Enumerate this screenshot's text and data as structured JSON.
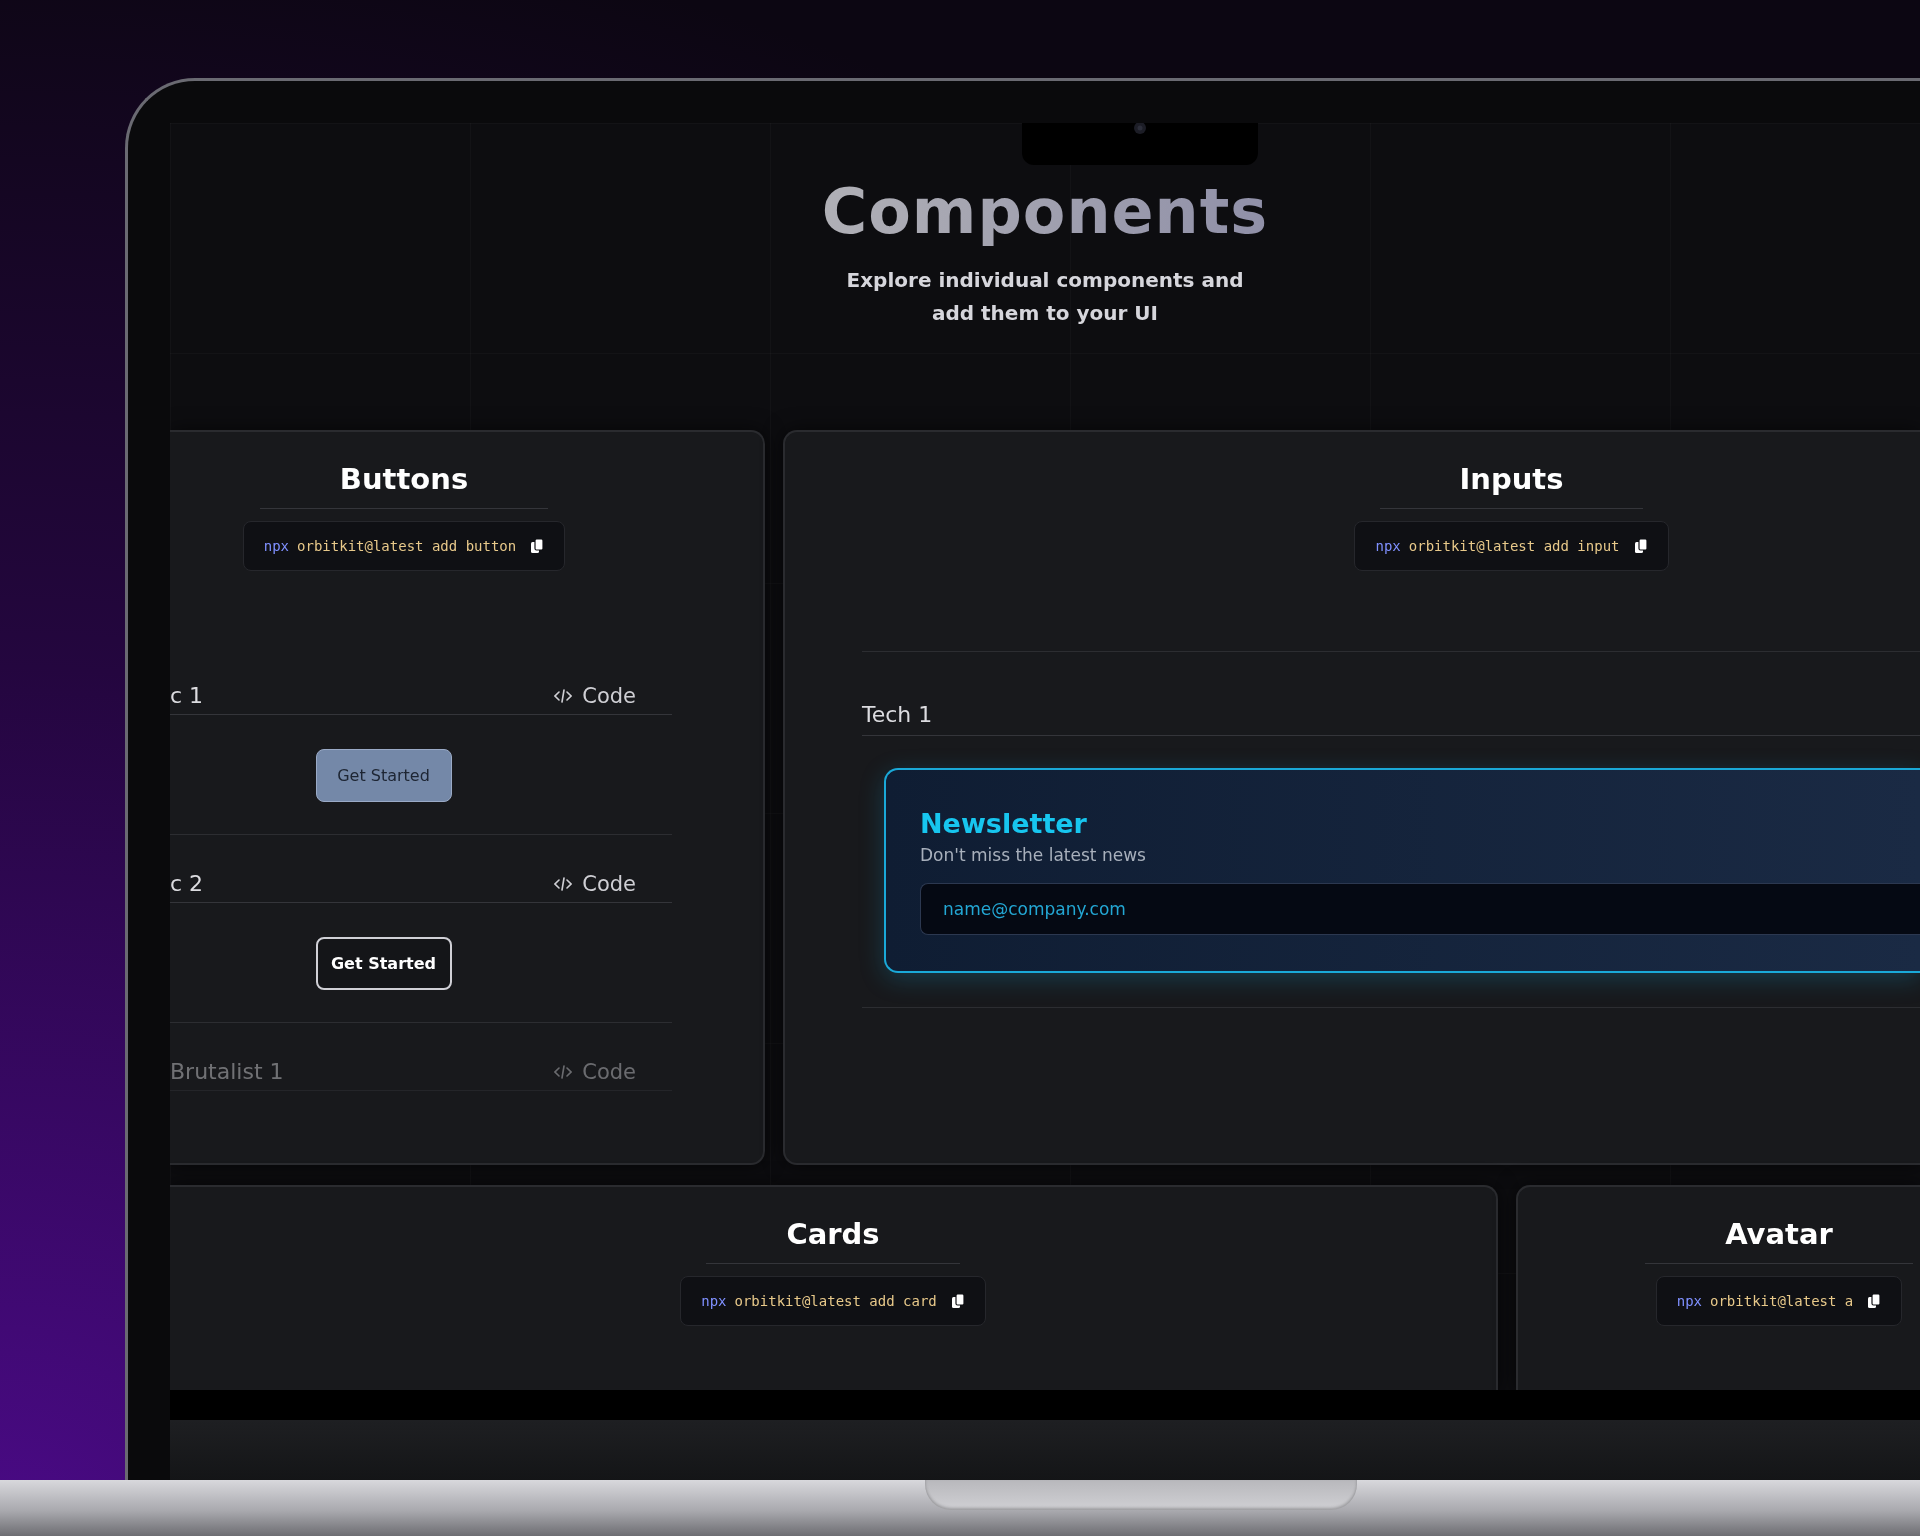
{
  "header": {
    "title": "Components",
    "subtitle_lines": [
      "Explore individual components and",
      "add them to your UI"
    ]
  },
  "panels": [
    {
      "kind": "buttons",
      "title": "Buttons",
      "install": {
        "prefix": "npx",
        "command": "orbitkit@latest add button"
      },
      "rows": [
        {
          "label": "c 1",
          "code": "Code",
          "dimmed": false,
          "button": {
            "label": "Get Started",
            "kind": "filled"
          }
        },
        {
          "label": "c 2",
          "code": "Code",
          "dimmed": false,
          "button": {
            "label": "Get Started",
            "kind": "outline"
          }
        },
        {
          "label": "Brutalist 1",
          "code": "Code",
          "dimmed": true
        }
      ]
    },
    {
      "kind": "inputs",
      "title": "Inputs",
      "install": {
        "prefix": "npx",
        "command": "orbitkit@latest add input"
      },
      "rows": [
        {
          "label": "Tech 1",
          "card": {
            "title": "Newsletter",
            "text": "Don't miss the latest news",
            "placeholder": "name@company.com"
          }
        }
      ]
    },
    {
      "kind": "plain",
      "title": "Cards",
      "install": {
        "prefix": "npx",
        "command": "orbitkit@latest add card"
      }
    },
    {
      "kind": "plain",
      "title": "Avatar",
      "install": {
        "prefix": "npx",
        "command": "orbitkit@latest a"
      }
    }
  ]
}
